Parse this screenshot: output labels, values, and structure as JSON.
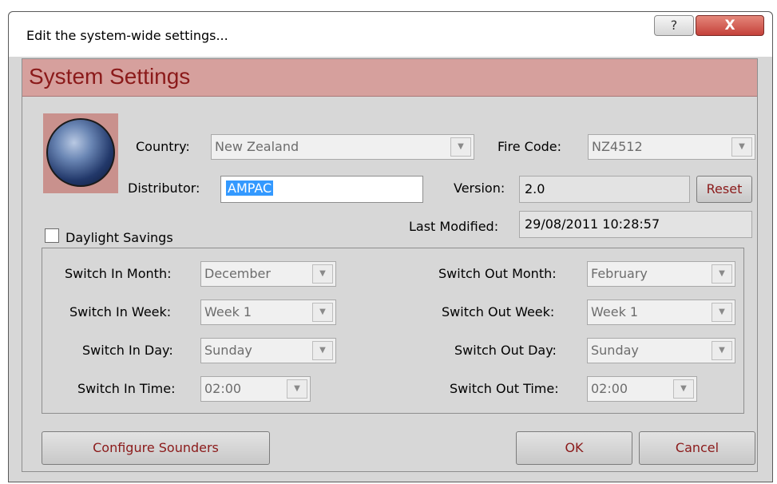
{
  "window": {
    "title": "Edit the system-wide settings...",
    "help_label": "?",
    "close_label": "X"
  },
  "header": {
    "title": "System Settings"
  },
  "form": {
    "country": {
      "label": "Country:",
      "value": "New Zealand"
    },
    "fire_code": {
      "label": "Fire Code:",
      "value": "NZ4512"
    },
    "distributor": {
      "label": "Distributor:",
      "value": "AMPAC"
    },
    "version": {
      "label": "Version:",
      "value": "2.0"
    },
    "reset_label": "Reset",
    "last_modified": {
      "label": "Last Modified:",
      "value": "29/08/2011 10:28:57"
    },
    "daylight_savings": {
      "label": "Daylight Savings",
      "checked": false
    }
  },
  "dst": {
    "switch_in_month": {
      "label": "Switch In Month:",
      "value": "December"
    },
    "switch_in_week": {
      "label": "Switch In Week:",
      "value": "Week 1"
    },
    "switch_in_day": {
      "label": "Switch In Day:",
      "value": "Sunday"
    },
    "switch_in_time": {
      "label": "Switch In Time:",
      "value": "02:00"
    },
    "switch_out_month": {
      "label": "Switch Out Month:",
      "value": "February"
    },
    "switch_out_week": {
      "label": "Switch Out Week:",
      "value": "Week 1"
    },
    "switch_out_day": {
      "label": "Switch Out Day:",
      "value": "Sunday"
    },
    "switch_out_time": {
      "label": "Switch Out Time:",
      "value": "02:00"
    }
  },
  "footer": {
    "configure_label": "Configure Sounders",
    "ok_label": "OK",
    "cancel_label": "Cancel"
  },
  "colors": {
    "header_bg": "#d6a09d",
    "header_text": "#8b1a1a",
    "button_text": "#8b1a1a",
    "selection": "#3399ff"
  },
  "icons": {
    "globe": "globe-icon",
    "dropdown": "chevron-down-icon",
    "help": "help-icon",
    "close": "close-icon"
  }
}
